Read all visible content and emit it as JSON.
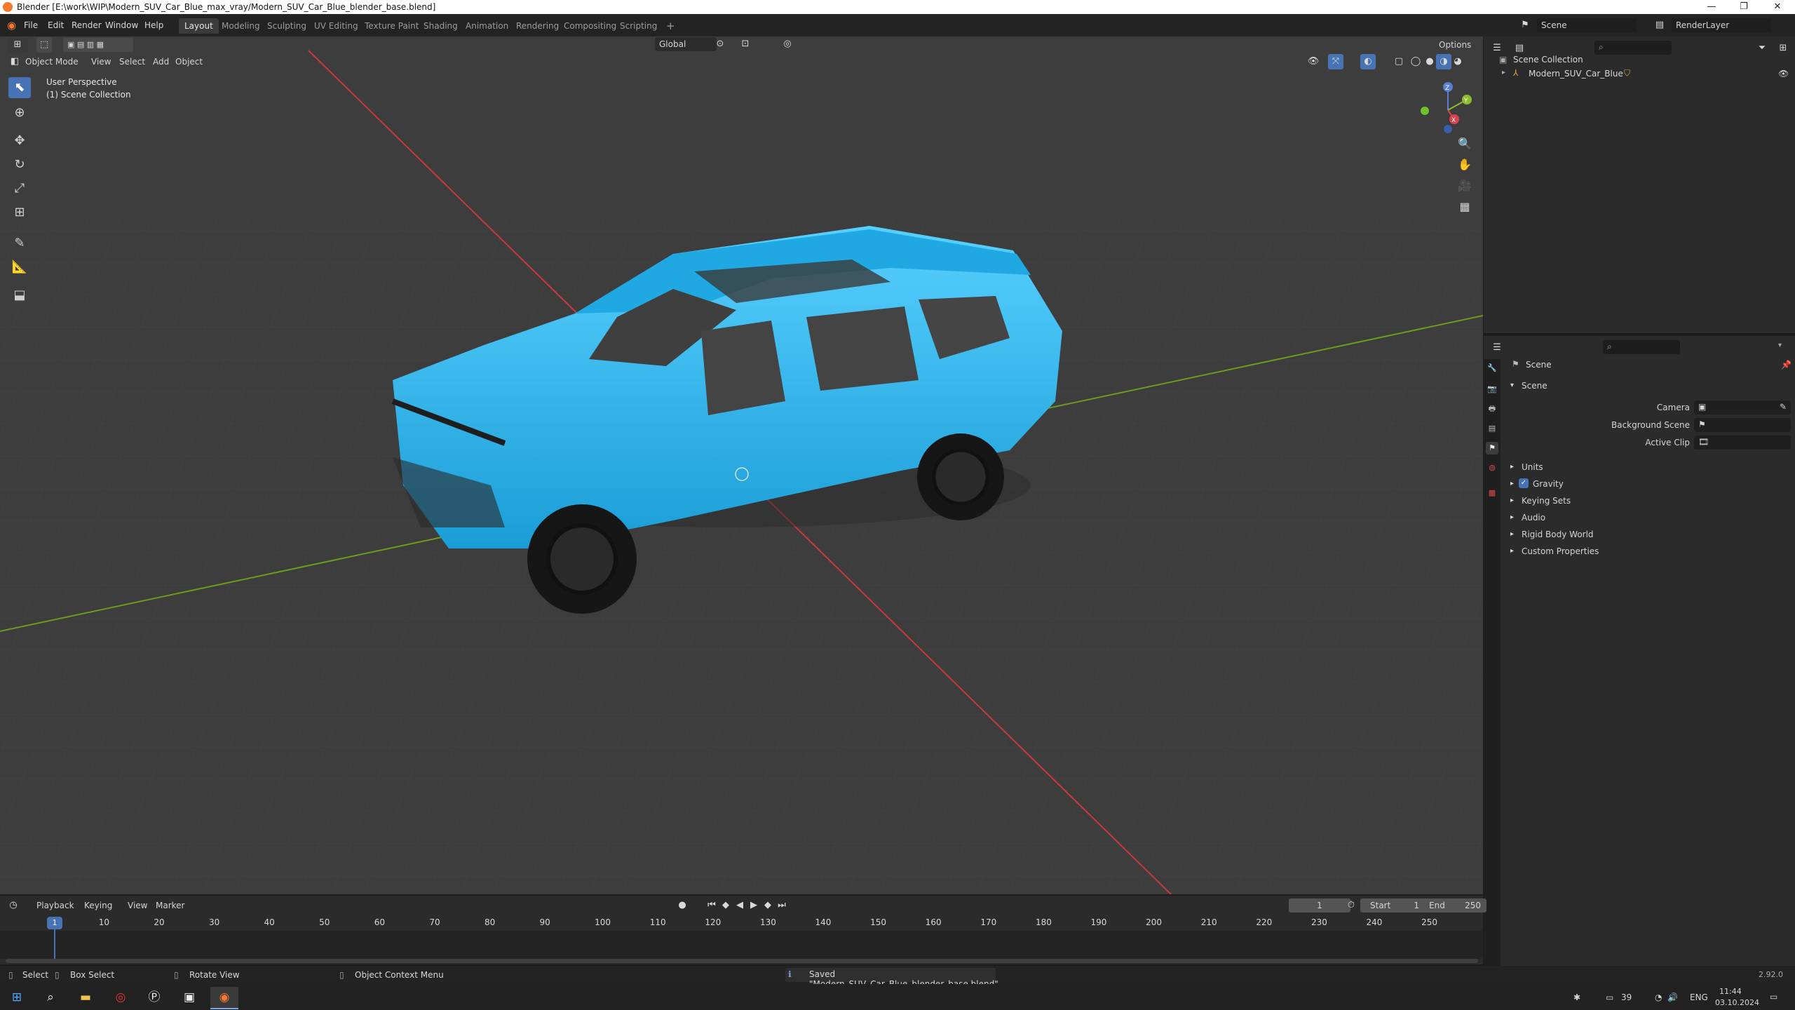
{
  "window": {
    "title": "Blender [E:\\work\\WIP\\Modern_SUV_Car_Blue_max_vray/Modern_SUV_Car_Blue_blender_base.blend]",
    "minimize": "—",
    "maximize": "❐",
    "close": "✕"
  },
  "menu": {
    "items": [
      "File",
      "Edit",
      "Render",
      "Window",
      "Help"
    ]
  },
  "workspaces": {
    "tabs": [
      "Layout",
      "Modeling",
      "Sculpting",
      "UV Editing",
      "Texture Paint",
      "Shading",
      "Animation",
      "Rendering",
      "Compositing",
      "Scripting"
    ],
    "add": "+"
  },
  "top_right": {
    "scene": "Scene",
    "view_layer": "RenderLayer"
  },
  "viewport": {
    "mode": "Object Mode",
    "menus": [
      "View",
      "Select",
      "Add",
      "Object"
    ],
    "transform_orientation": "Global",
    "options": "Options",
    "perspective_label": "User Perspective",
    "collection_label": "(1) Scene Collection",
    "gizmo": {
      "x": "X",
      "y": "Y",
      "z": "Z"
    },
    "car_color": "#2fb6ec"
  },
  "outliner": {
    "root": "Scene Collection",
    "items": [
      "Modern_SUV_Car_Blue"
    ]
  },
  "properties": {
    "header": "Scene",
    "section": "Scene",
    "fields": [
      {
        "label": "Camera"
      },
      {
        "label": "Background Scene"
      },
      {
        "label": "Active Clip"
      }
    ],
    "subpanels": [
      "Units",
      "Gravity",
      "Keying Sets",
      "Audio",
      "Rigid Body World",
      "Custom Properties"
    ],
    "gravity_checked": true
  },
  "timeline": {
    "menus": [
      "Playback",
      "Keying",
      "View",
      "Marker"
    ],
    "current_frame": "1",
    "start_label": "Start",
    "start": "1",
    "end_label": "End",
    "end": "250",
    "ruler": [
      "10",
      "20",
      "30",
      "40",
      "50",
      "60",
      "70",
      "80",
      "90",
      "100",
      "110",
      "120",
      "130",
      "140",
      "150",
      "160",
      "170",
      "180",
      "190",
      "200",
      "210",
      "220",
      "230",
      "240",
      "250"
    ],
    "playhead": "1"
  },
  "statusbar": {
    "select": "Select",
    "box_select": "Box Select",
    "rotate_view": "Rotate View",
    "context_menu": "Object Context Menu",
    "message": "Saved \"Modern_SUV_Car_Blue_blender_base.blend\"",
    "version": "2.92.0"
  },
  "taskbar": {
    "temperature": "39",
    "language": "ENG",
    "time": "11:44",
    "date": "03.10.2024"
  },
  "colors": {
    "accent": "#4772b3",
    "x_axis": "#c8393f",
    "y_axis": "#6b9c1f",
    "blender_orange": "#f5792a"
  }
}
